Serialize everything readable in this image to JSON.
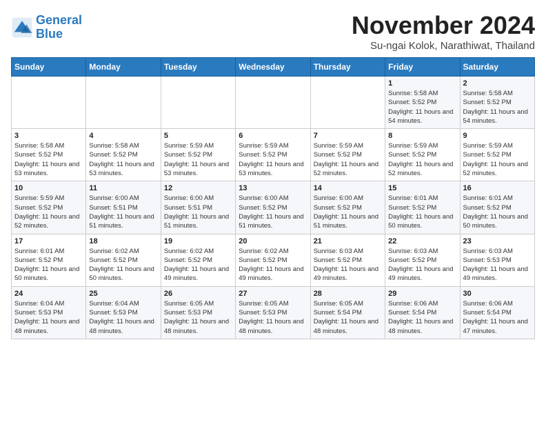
{
  "header": {
    "logo_line1": "General",
    "logo_line2": "Blue",
    "month": "November 2024",
    "location": "Su-ngai Kolok, Narathiwat, Thailand"
  },
  "weekdays": [
    "Sunday",
    "Monday",
    "Tuesday",
    "Wednesday",
    "Thursday",
    "Friday",
    "Saturday"
  ],
  "weeks": [
    [
      {
        "day": null
      },
      {
        "day": null
      },
      {
        "day": null
      },
      {
        "day": null
      },
      {
        "day": null
      },
      {
        "day": "1",
        "sunrise": "5:58 AM",
        "sunset": "5:52 PM",
        "daylight": "11 hours and 54 minutes."
      },
      {
        "day": "2",
        "sunrise": "5:58 AM",
        "sunset": "5:52 PM",
        "daylight": "11 hours and 54 minutes."
      }
    ],
    [
      {
        "day": "3",
        "sunrise": "5:58 AM",
        "sunset": "5:52 PM",
        "daylight": "11 hours and 53 minutes."
      },
      {
        "day": "4",
        "sunrise": "5:58 AM",
        "sunset": "5:52 PM",
        "daylight": "11 hours and 53 minutes."
      },
      {
        "day": "5",
        "sunrise": "5:59 AM",
        "sunset": "5:52 PM",
        "daylight": "11 hours and 53 minutes."
      },
      {
        "day": "6",
        "sunrise": "5:59 AM",
        "sunset": "5:52 PM",
        "daylight": "11 hours and 53 minutes."
      },
      {
        "day": "7",
        "sunrise": "5:59 AM",
        "sunset": "5:52 PM",
        "daylight": "11 hours and 52 minutes."
      },
      {
        "day": "8",
        "sunrise": "5:59 AM",
        "sunset": "5:52 PM",
        "daylight": "11 hours and 52 minutes."
      },
      {
        "day": "9",
        "sunrise": "5:59 AM",
        "sunset": "5:52 PM",
        "daylight": "11 hours and 52 minutes."
      }
    ],
    [
      {
        "day": "10",
        "sunrise": "5:59 AM",
        "sunset": "5:52 PM",
        "daylight": "11 hours and 52 minutes."
      },
      {
        "day": "11",
        "sunrise": "6:00 AM",
        "sunset": "5:51 PM",
        "daylight": "11 hours and 51 minutes."
      },
      {
        "day": "12",
        "sunrise": "6:00 AM",
        "sunset": "5:51 PM",
        "daylight": "11 hours and 51 minutes."
      },
      {
        "day": "13",
        "sunrise": "6:00 AM",
        "sunset": "5:52 PM",
        "daylight": "11 hours and 51 minutes."
      },
      {
        "day": "14",
        "sunrise": "6:00 AM",
        "sunset": "5:52 PM",
        "daylight": "11 hours and 51 minutes."
      },
      {
        "day": "15",
        "sunrise": "6:01 AM",
        "sunset": "5:52 PM",
        "daylight": "11 hours and 50 minutes."
      },
      {
        "day": "16",
        "sunrise": "6:01 AM",
        "sunset": "5:52 PM",
        "daylight": "11 hours and 50 minutes."
      }
    ],
    [
      {
        "day": "17",
        "sunrise": "6:01 AM",
        "sunset": "5:52 PM",
        "daylight": "11 hours and 50 minutes."
      },
      {
        "day": "18",
        "sunrise": "6:02 AM",
        "sunset": "5:52 PM",
        "daylight": "11 hours and 50 minutes."
      },
      {
        "day": "19",
        "sunrise": "6:02 AM",
        "sunset": "5:52 PM",
        "daylight": "11 hours and 49 minutes."
      },
      {
        "day": "20",
        "sunrise": "6:02 AM",
        "sunset": "5:52 PM",
        "daylight": "11 hours and 49 minutes."
      },
      {
        "day": "21",
        "sunrise": "6:03 AM",
        "sunset": "5:52 PM",
        "daylight": "11 hours and 49 minutes."
      },
      {
        "day": "22",
        "sunrise": "6:03 AM",
        "sunset": "5:52 PM",
        "daylight": "11 hours and 49 minutes."
      },
      {
        "day": "23",
        "sunrise": "6:03 AM",
        "sunset": "5:53 PM",
        "daylight": "11 hours and 49 minutes."
      }
    ],
    [
      {
        "day": "24",
        "sunrise": "6:04 AM",
        "sunset": "5:53 PM",
        "daylight": "11 hours and 48 minutes."
      },
      {
        "day": "25",
        "sunrise": "6:04 AM",
        "sunset": "5:53 PM",
        "daylight": "11 hours and 48 minutes."
      },
      {
        "day": "26",
        "sunrise": "6:05 AM",
        "sunset": "5:53 PM",
        "daylight": "11 hours and 48 minutes."
      },
      {
        "day": "27",
        "sunrise": "6:05 AM",
        "sunset": "5:53 PM",
        "daylight": "11 hours and 48 minutes."
      },
      {
        "day": "28",
        "sunrise": "6:05 AM",
        "sunset": "5:54 PM",
        "daylight": "11 hours and 48 minutes."
      },
      {
        "day": "29",
        "sunrise": "6:06 AM",
        "sunset": "5:54 PM",
        "daylight": "11 hours and 48 minutes."
      },
      {
        "day": "30",
        "sunrise": "6:06 AM",
        "sunset": "5:54 PM",
        "daylight": "11 hours and 47 minutes."
      }
    ]
  ]
}
